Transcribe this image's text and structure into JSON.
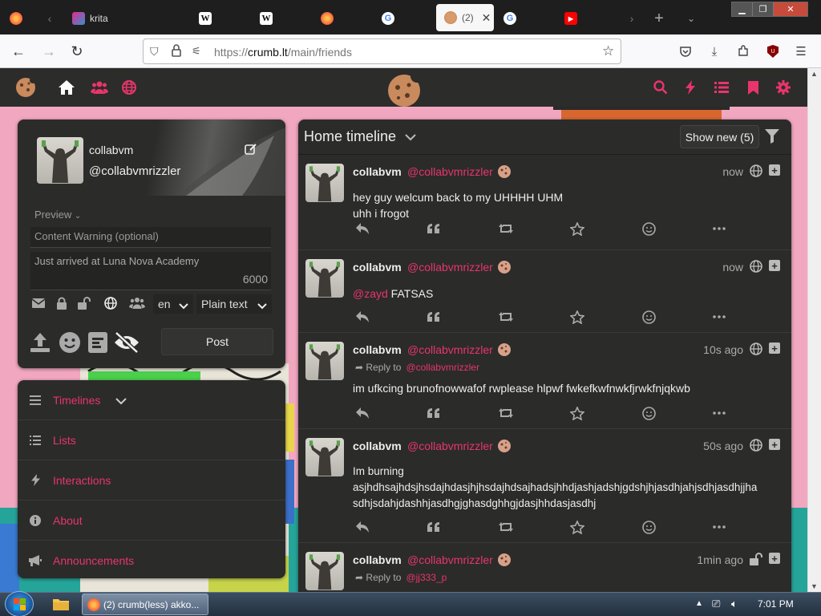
{
  "browser": {
    "tabs": [
      {
        "title": "",
        "icon": "firefox-icon"
      },
      {
        "title": "krita",
        "icon": "krita-icon"
      },
      {
        "title": "",
        "icon": "wikipedia-icon"
      },
      {
        "title": "",
        "icon": "wikipedia-icon"
      },
      {
        "title": "",
        "icon": "firefox-icon"
      },
      {
        "title": "",
        "icon": "google-icon"
      },
      {
        "title": "(2)",
        "icon": "cookie-icon",
        "active": true
      },
      {
        "title": "",
        "icon": "google-icon"
      },
      {
        "title": "",
        "icon": "youtube-icon"
      }
    ],
    "url_prefix": "https://",
    "url_host": "crumb.lt",
    "url_path": "/main/friends",
    "window_controls": [
      "minimize",
      "restore",
      "close"
    ]
  },
  "topbar": {
    "left_icons": [
      "home-icon",
      "users-icon",
      "globe-icon"
    ],
    "right_icons": [
      "search-icon",
      "bolt-icon",
      "list-icon",
      "bookmark-icon",
      "gear-icon"
    ],
    "accent": "#e8356b"
  },
  "postform": {
    "name": "collabvm",
    "handle": "@collabvmrizzler",
    "preview_label": "Preview",
    "cw_placeholder": "Content Warning (optional)",
    "status_text": "Just arrived at Luna Nova Academy",
    "char_count": "6000",
    "language": "en",
    "format": "Plain text",
    "post_label": "Post"
  },
  "nav": {
    "items": [
      {
        "label": "Timelines",
        "icon": "bars-icon"
      },
      {
        "label": "Lists",
        "icon": "list-icon"
      },
      {
        "label": "Interactions",
        "icon": "bolt-icon"
      },
      {
        "label": "About",
        "icon": "info-icon"
      },
      {
        "label": "Announcements",
        "icon": "megaphone-icon"
      }
    ]
  },
  "timeline": {
    "title": "Home timeline",
    "show_new": "Show new (5)",
    "posts": [
      {
        "name": "collabvm",
        "handle": "@collabvmrizzler",
        "time": "now",
        "visibility": "globe-icon",
        "reply_to": "",
        "body": "hey guy welcum back to my UHHHH UHM\nuhh i frogot"
      },
      {
        "name": "collabvm",
        "handle": "@collabvmrizzler",
        "time": "now",
        "visibility": "globe-icon",
        "reply_to": "",
        "mention": "@zayd",
        "body": " FATSAS"
      },
      {
        "name": "collabvm",
        "handle": "@collabvmrizzler",
        "time": "10s ago",
        "visibility": "globe-icon",
        "reply_label": "Reply to",
        "reply_to": "@collabvmrizzler",
        "body": "im ufkcing brunofnowwafof rwplease hlpwf fwkefkwfnwkfjrwkfnjqkwb"
      },
      {
        "name": "collabvm",
        "handle": "@collabvmrizzler",
        "time": "50s ago",
        "visibility": "globe-icon",
        "reply_to": "",
        "body": "Im burning\nasjhdhsajhdsjhsdajhdasjhjhsdajhdsajhadsjhhdjashjadshjgdshjhjasdhjahjsdhjasdhjjha\nsdhjsdahjdashhjasdhgjghasdghhgjdasjhhdasjasdhj"
      },
      {
        "name": "collabvm",
        "handle": "@collabvmrizzler",
        "time": "1min ago",
        "visibility": "unlock-icon",
        "reply_label": "Reply to",
        "reply_to": "@jj333_p",
        "body": ""
      }
    ]
  },
  "taskbar": {
    "app_label": "(2) crumb(less) akko...",
    "clock": "7:01 PM"
  }
}
